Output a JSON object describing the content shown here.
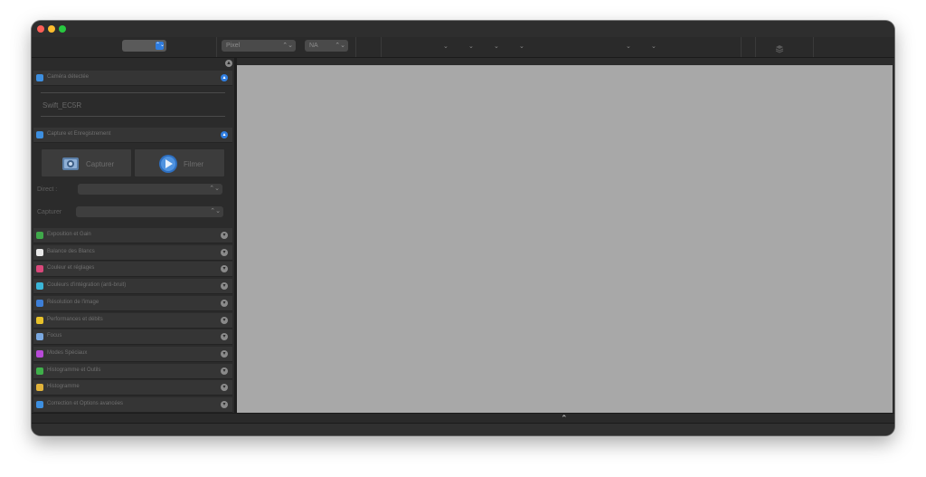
{
  "toolbar": {
    "unit_popup": "Pixel",
    "na_popup": "NA",
    "popup_arrows": "⌃⌄",
    "chevron": "⌄"
  },
  "sidebar": {
    "collapse_all": "▲",
    "sections": [
      {
        "label": "Caméra détectée",
        "expanded": true,
        "icon": "camera-detected-icon",
        "color": "#3d8fe0"
      },
      {
        "label": "Capture et Enregistrement",
        "expanded": true,
        "icon": "capture-record-icon",
        "color": "#3d8fe0"
      }
    ],
    "camera_name": "Swift_EC5R",
    "capture_button": "Capturer",
    "film_button": "Filmer",
    "folder_label": "Direct :",
    "capture_label": "Capturer",
    "panels": [
      {
        "label": "Exposition et Gain",
        "icon": "exposure-gain-icon",
        "color": "#3fa84a"
      },
      {
        "label": "Balance des Blancs",
        "icon": "white-balance-icon",
        "color": "#e8e8e8"
      },
      {
        "label": "Couleur et réglages",
        "icon": "color-settings-icon",
        "color": "#d9487a"
      },
      {
        "label": "Couleurs d'intégration (anti-bruit)",
        "icon": "integration-colors-icon",
        "color": "#3bb6d8"
      },
      {
        "label": "Résolution de l'image",
        "icon": "image-resolution-icon",
        "color": "#3d7fd8"
      },
      {
        "label": "Performances et débits",
        "icon": "performance-icon",
        "color": "#e8c22a"
      },
      {
        "label": "Focus",
        "icon": "focus-icon",
        "color": "#7aa8e0"
      },
      {
        "label": "Modes Spéciaux",
        "icon": "special-modes-icon",
        "color": "#b84ad8"
      },
      {
        "label": "Histogramme et Outils",
        "icon": "histogram-icon",
        "color": "#3fb04a"
      },
      {
        "label": "Histogramme",
        "icon": "chart-icon",
        "color": "#e0b23a"
      },
      {
        "label": "Correction et Options avancées",
        "icon": "advanced-options-icon",
        "color": "#3d8fe0"
      }
    ],
    "expand_glyph": "▾",
    "collapse_glyph": "▴"
  },
  "bottom": {
    "toggle_glyph": "⌃"
  },
  "colors": {
    "accent": "#2f7de0",
    "content_bg": "#a8a8a8",
    "close": "#fe5f57",
    "minimize": "#febc2e",
    "zoom": "#28c840"
  }
}
